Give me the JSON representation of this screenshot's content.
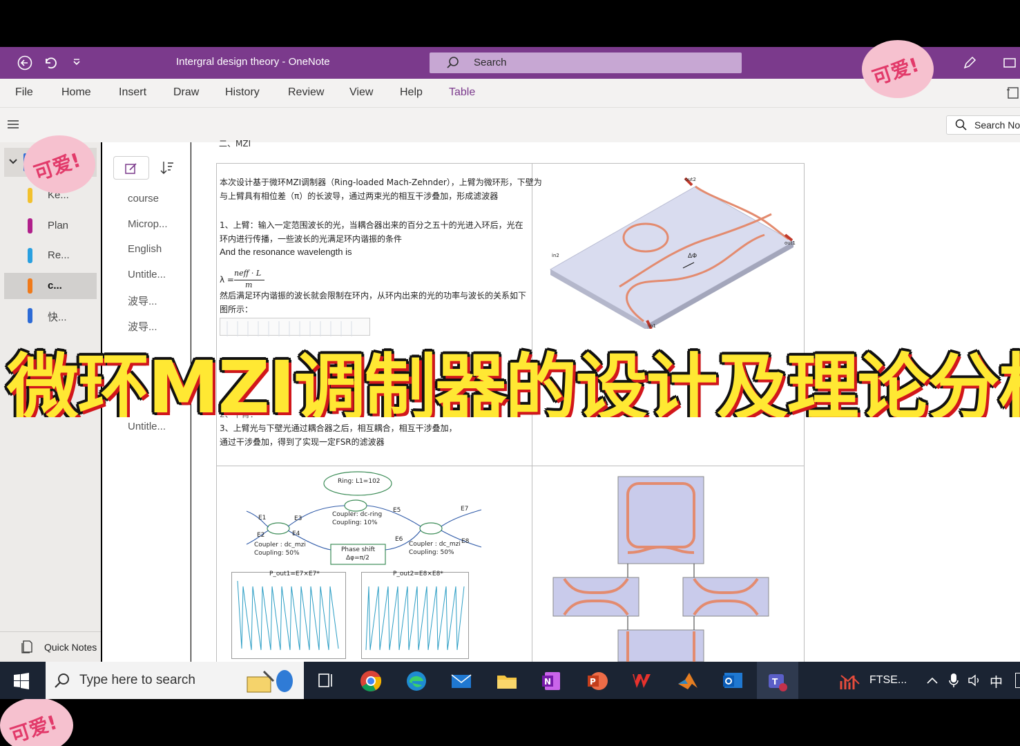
{
  "window": {
    "doc_title": "Intergral design theory  -  OneNote",
    "search_placeholder": "Search"
  },
  "menu": [
    "File",
    "Home",
    "Insert",
    "Draw",
    "History",
    "Review",
    "View",
    "Help",
    "Table"
  ],
  "search_notes": "Search Not",
  "sections": [
    {
      "label": "Ke...",
      "color": "#f2c12e"
    },
    {
      "label": "Plan",
      "color": "#b0208b"
    },
    {
      "label": "Re...",
      "color": "#2aa0e0"
    },
    {
      "label": "c...",
      "color": "#f07a1a"
    },
    {
      "label": "快...",
      "color": "#2d6bd6"
    }
  ],
  "quick_notes": "Quick Notes",
  "pages": [
    "course",
    "Microp...",
    "English",
    "Untitle...",
    "波导...",
    "波导...",
    "Untitle..."
  ],
  "note": {
    "heading": "二、MZI",
    "para1a": "本次设计基于微环MZI调制器（Ring-loaded Mach-Zehnder），上臂为微环形，下壁为",
    "para1b": "与上臂具有相位差（π）的长波导，通过两束光的相互干涉叠加，形成滤波器",
    "para2a": "1、上臂：输入一定范围波长的光，当耦合器出来的百分之五十的光进入环后，光在",
    "para2b": "环内进行传播，一些波长的光满足环内谐振的条件",
    "para2c": "And the resonance wavelength is",
    "formula_lhs": "λ =",
    "formula_num": "neff · L",
    "formula_den": "m",
    "para3a": "然后满足环内谐振的波长就会限制在环内，从环内出来的光的功率与波长的关系如下",
    "para3b": "图所示：",
    "para4a": "2、下臂：",
    "para4b": "3、上臂光与下壁光通过耦合器之后，相互耦合，相互干涉叠加，",
    "para4c": "通过干涉叠加，得到了实现一定FSR的滤波器"
  },
  "device": {
    "out2": "out2",
    "out1": "out1",
    "in2": "in2",
    "in1": "in1",
    "phase": "ΔΦ"
  },
  "schematic": {
    "ring": "Ring: L1=102",
    "coupler_ring": "Coupler: dc-ring",
    "coupling_ring": "Coupling: 10%",
    "coupler_left": "Coupler : dc_mzi",
    "coupling_left": "Coupling: 50%",
    "coupler_right": "Coupler : dc_mzi",
    "coupling_right": "Coupling: 50%",
    "phase_shift": "Phase shift",
    "phase_value": "Δφ=π/2",
    "e1": "E1",
    "e2": "E2",
    "e3": "E3",
    "e4": "E4",
    "e5": "E5",
    "e6": "E6",
    "e7": "E7",
    "e8": "E8"
  },
  "plots": {
    "title1": "P_out1=E7×E7*",
    "title2": "P_out2=E8×E8*"
  },
  "headline": "微环MZI调制器的设计及理论分析（含MA",
  "sticker_text": "可爱!",
  "taskbar": {
    "search_placeholder": "Type here to search",
    "app_label": "FTSE...",
    "ime": "中"
  },
  "colors": {
    "title_bar": "#7b3a8c",
    "accent": "#7b3a8c",
    "headline_fill": "#ffe833",
    "headline_outline": "#d2161b"
  }
}
